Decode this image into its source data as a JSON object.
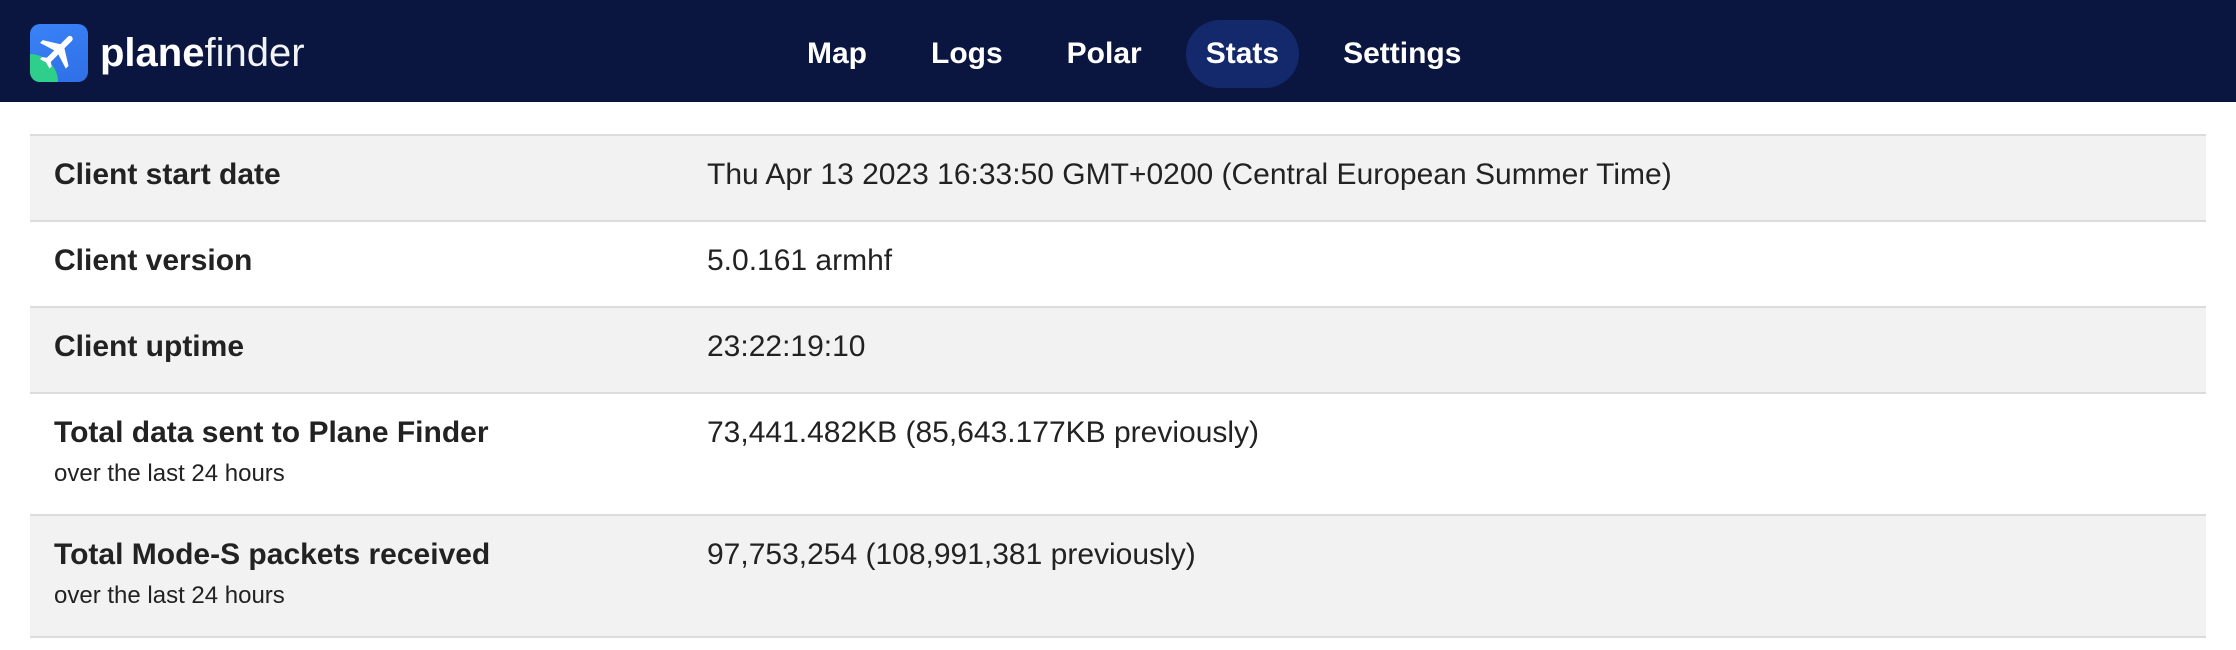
{
  "brand": {
    "name_bold": "plane",
    "name_light": "finder",
    "colors": {
      "navbar": "#0a1640",
      "active_tab": "#13296b",
      "logo_blue": "#3a82f7",
      "logo_green": "#2ecf8a"
    }
  },
  "nav": {
    "items": [
      {
        "label": "Map"
      },
      {
        "label": "Logs"
      },
      {
        "label": "Polar"
      },
      {
        "label": "Stats",
        "active": true
      },
      {
        "label": "Settings"
      }
    ]
  },
  "stats": {
    "rows": [
      {
        "label": "Client start date",
        "value": "Thu Apr 13 2023 16:33:50 GMT+0200 (Central European Summer Time)"
      },
      {
        "label": "Client version",
        "value": "5.0.161 armhf"
      },
      {
        "label": "Client uptime",
        "value": "23:22:19:10"
      },
      {
        "label": "Total data sent to Plane Finder",
        "sublabel": "over the last 24 hours",
        "value": "73,441.482KB (85,643.177KB previously)"
      },
      {
        "label": "Total Mode-S packets received",
        "sublabel": "over the last 24 hours",
        "value": "97,753,254 (108,991,381 previously)"
      }
    ]
  }
}
